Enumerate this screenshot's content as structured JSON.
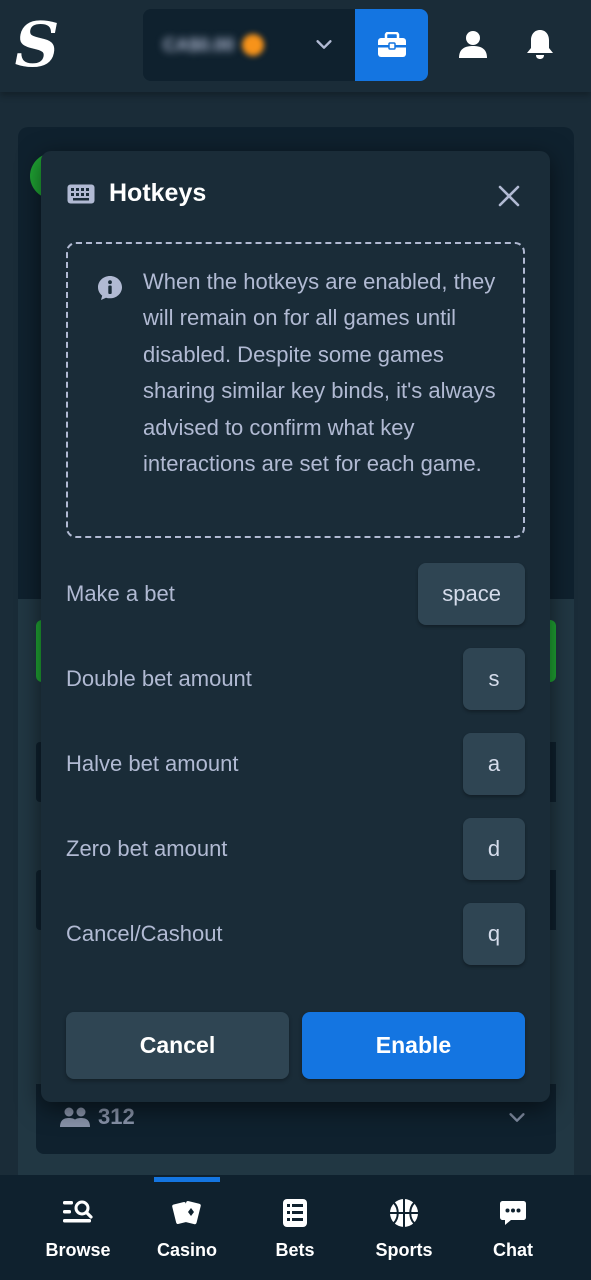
{
  "header": {
    "logo_text": "S",
    "wallet_balance": "CA$0.00",
    "wallet_icon": "wallet-icon",
    "user_icon": "user-icon",
    "notifications_icon": "bell-icon"
  },
  "background": {
    "players_count": "312"
  },
  "modal": {
    "title": "Hotkeys",
    "title_icon": "keyboard-icon",
    "info_text": "When the hotkeys are enabled, they will remain on for all games until disabled. Despite some games sharing similar key binds, it's always advised to confirm what key interactions are set for each game.",
    "hotkeys": [
      {
        "label": "Make a bet",
        "key": "space"
      },
      {
        "label": "Double bet amount",
        "key": "s"
      },
      {
        "label": "Halve bet amount",
        "key": "a"
      },
      {
        "label": "Zero bet amount",
        "key": "d"
      },
      {
        "label": "Cancel/Cashout",
        "key": "q"
      }
    ],
    "cancel_label": "Cancel",
    "enable_label": "Enable"
  },
  "bottom_nav": {
    "items": [
      {
        "label": "Browse",
        "icon": "browse-icon"
      },
      {
        "label": "Casino",
        "icon": "casino-cards-icon",
        "active": true
      },
      {
        "label": "Bets",
        "icon": "bets-list-icon"
      },
      {
        "label": "Sports",
        "icon": "basketball-icon"
      },
      {
        "label": "Chat",
        "icon": "chat-icon"
      }
    ]
  },
  "colors": {
    "background": "#1a2c38",
    "surface_dark": "#0f212e",
    "key_bg": "#2f4553",
    "accent_blue": "#1475e1",
    "muted_text": "#b1bad3",
    "green": "#1fa333"
  }
}
